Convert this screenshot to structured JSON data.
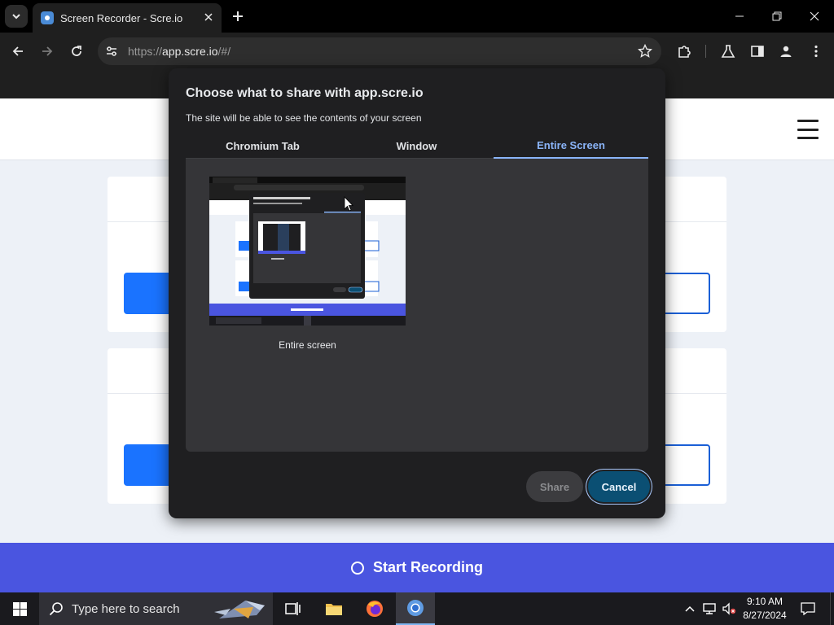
{
  "browser": {
    "tab_title": "Screen Recorder - Scre.io",
    "url_scheme": "https://",
    "url_host": "app.scre.io",
    "url_path": "/#/"
  },
  "dialog": {
    "title": "Choose what to share with app.scre.io",
    "subtitle": "The site will be able to see the contents of your screen",
    "tabs": [
      {
        "label": "Chromium Tab",
        "active": false
      },
      {
        "label": "Window",
        "active": false
      },
      {
        "label": "Entire Screen",
        "active": true
      }
    ],
    "source_label": "Entire screen",
    "share_label": "Share",
    "cancel_label": "Cancel"
  },
  "page": {
    "record_label": "Start Recording"
  },
  "taskbar": {
    "search_placeholder": "Type here to search",
    "time": "9:10 AM",
    "date": "8/27/2024"
  },
  "colors": {
    "accent_blue": "#8ab4f8",
    "record_bar": "#4a55e0",
    "cancel_bg": "#0b4f73",
    "page_button": "#1a73ff"
  },
  "icons": {
    "tab_list": "chevron-down-icon",
    "close": "close-icon",
    "new_tab": "plus-icon",
    "back": "back-arrow-icon",
    "forward": "forward-arrow-icon",
    "reload": "reload-icon",
    "site_info": "tune-icon",
    "bookmark": "star-icon",
    "extensions": "puzzle-icon",
    "labs": "flask-icon",
    "side_panel": "side-panel-icon",
    "profile": "person-icon",
    "menu": "kebab-menu-icon",
    "record": "circle-outline-icon",
    "windows_start": "windows-logo-icon",
    "search": "search-icon"
  }
}
